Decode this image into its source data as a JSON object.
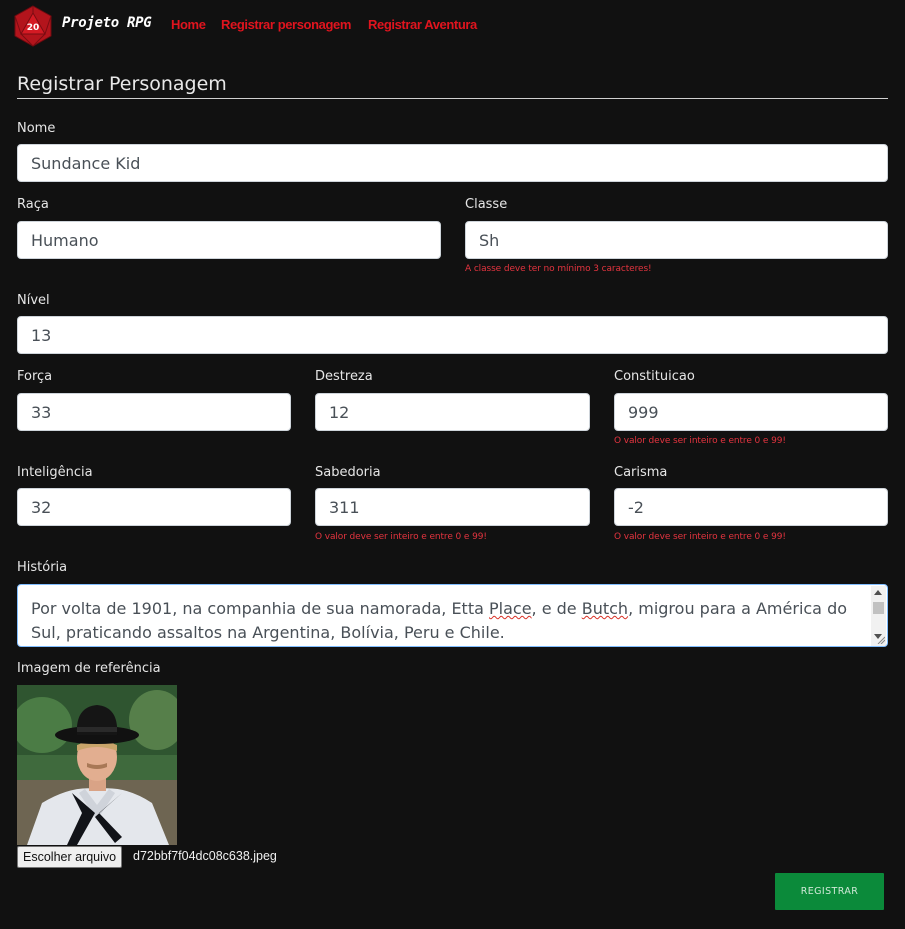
{
  "navbar": {
    "logo_number": "20",
    "brand": "Projeto RPG",
    "links": [
      "Home",
      "Registrar personagem",
      "Registrar Aventura"
    ]
  },
  "page_title": "Registrar Personagem",
  "fields": {
    "nome": {
      "label": "Nome",
      "value": "Sundance Kid"
    },
    "raca": {
      "label": "Raça",
      "value": "Humano"
    },
    "classe": {
      "label": "Classe",
      "value": "Sh",
      "error": "A classe deve ter no mínimo 3 caracteres!"
    },
    "nivel": {
      "label": "Nível",
      "value": "13"
    },
    "forca": {
      "label": "Força",
      "value": "33"
    },
    "destreza": {
      "label": "Destreza",
      "value": "12"
    },
    "constituicao": {
      "label": "Constituicao",
      "value": "999",
      "error": "O valor deve ser inteiro e entre 0 e 99!"
    },
    "inteligencia": {
      "label": "Inteligência",
      "value": "32"
    },
    "sabedoria": {
      "label": "Sabedoria",
      "value": "311",
      "error": "O valor deve ser inteiro e entre 0 e 99!"
    },
    "carisma": {
      "label": "Carisma",
      "value": "-2",
      "error": "O valor deve ser inteiro e entre 0 e 99!"
    }
  },
  "historia": {
    "label": "História",
    "text_before_place": "Por volta de 1901, na companhia de sua namorada, Etta ",
    "word_place": "Place",
    "text_middle": ", e de ",
    "word_butch": "Butch",
    "text_after": ", migrou para a América do Sul, praticando assaltos na Argentina, Bolívia, Peru e Chile."
  },
  "imagem": {
    "label": "Imagem de referência",
    "choose_button": "Escolher arquivo",
    "file_name": "d72bbf7f04dc08c638.jpeg"
  },
  "submit_label": "REGISTRAR",
  "colors": {
    "background": "#111111",
    "nav_link": "#e0141e",
    "error": "#e3343f",
    "submit": "#0b8a3a",
    "logo_red": "#b3141c"
  }
}
